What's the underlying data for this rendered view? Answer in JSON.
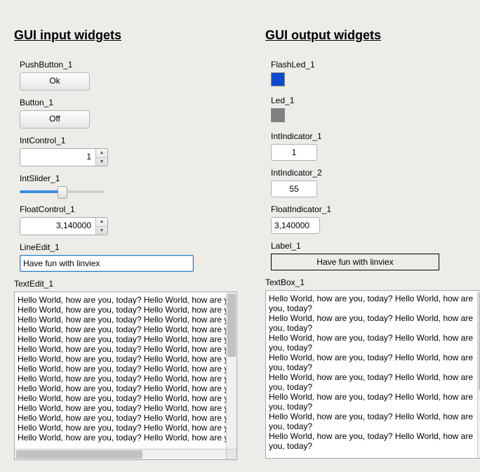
{
  "headings": {
    "input": "GUI input widgets",
    "output": "GUI output widgets"
  },
  "input": {
    "push_button": {
      "label": "PushButton_1",
      "text": "Ok"
    },
    "button": {
      "label": "Button_1",
      "text": "Off"
    },
    "int_control": {
      "label": "IntControl_1",
      "value": "1"
    },
    "int_slider": {
      "label": "IntSlider_1",
      "pct": 50
    },
    "float_control": {
      "label": "FloatControl_1",
      "value": "3,140000"
    },
    "line_edit": {
      "label": "LineEdit_1",
      "value": "Have fun with linviex"
    },
    "text_edit": {
      "label": "TextEdit_1",
      "line": "Hello World, how are you, today? Hello World, how are you",
      "repeat": 15
    }
  },
  "output": {
    "flash_led": {
      "label": "FlashLed_1",
      "color": "blue"
    },
    "led": {
      "label": "Led_1",
      "color": "gray"
    },
    "int_ind_1": {
      "label": "IntIndicator_1",
      "value": "1"
    },
    "int_ind_2": {
      "label": "IntIndicator_2",
      "value": "55"
    },
    "float_ind": {
      "label": "FloatIndicator_1",
      "value": "3,140000"
    },
    "label_widget": {
      "label": "Label_1",
      "value": "Have fun with linviex"
    },
    "text_box": {
      "label": "TextBox_1",
      "line": "Hello World, how are you, today? Hello World, how are you, today?",
      "repeat": 8
    }
  },
  "icons": {
    "up": "▲",
    "down": "▼"
  }
}
